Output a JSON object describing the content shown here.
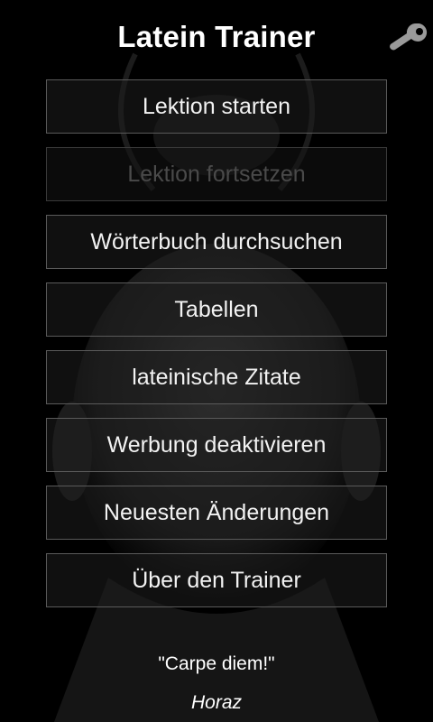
{
  "app": {
    "title": "Latein Trainer"
  },
  "icons": {
    "settings": "wrench-icon"
  },
  "menu": {
    "items": [
      {
        "label": "Lektion starten",
        "enabled": true
      },
      {
        "label": "Lektion fortsetzen",
        "enabled": false
      },
      {
        "label": "Wörterbuch durchsuchen",
        "enabled": true
      },
      {
        "label": "Tabellen",
        "enabled": true
      },
      {
        "label": "lateinische Zitate",
        "enabled": true
      },
      {
        "label": "Werbung deaktivieren",
        "enabled": true
      },
      {
        "label": "Neuesten Änderungen",
        "enabled": true
      },
      {
        "label": "Über den Trainer",
        "enabled": true
      }
    ]
  },
  "footer": {
    "quote": "\"Carpe diem!\"",
    "author": "Horaz"
  },
  "colors": {
    "background": "#000000",
    "button_border": "#5a5a5a",
    "text": "#ffffff",
    "disabled_text": "#4a4a4a"
  }
}
